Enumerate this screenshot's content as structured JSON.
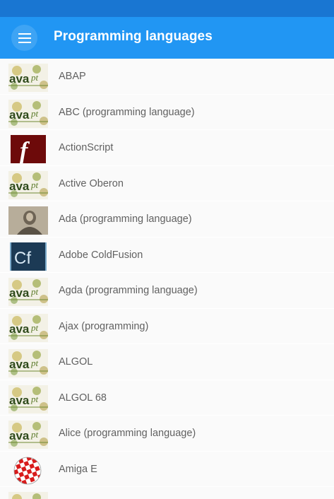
{
  "app_bar": {
    "title": "Programming languages",
    "menu_icon": "hamburger-menu-icon",
    "background": "#2196f3",
    "status_bar_color": "#1976d2"
  },
  "items": [
    {
      "label": "ABAP",
      "icon": "java-logo-icon"
    },
    {
      "label": "ABC (programming language)",
      "icon": "java-logo-icon"
    },
    {
      "label": "ActionScript",
      "icon": "flash-icon"
    },
    {
      "label": "Active Oberon",
      "icon": "java-logo-icon"
    },
    {
      "label": "Ada (programming language)",
      "icon": "ada-portrait-icon"
    },
    {
      "label": "Adobe ColdFusion",
      "icon": "coldfusion-icon"
    },
    {
      "label": "Agda (programming language)",
      "icon": "java-logo-icon"
    },
    {
      "label": "Ajax (programming)",
      "icon": "java-logo-icon"
    },
    {
      "label": "ALGOL",
      "icon": "java-logo-icon"
    },
    {
      "label": "ALGOL 68",
      "icon": "java-logo-icon"
    },
    {
      "label": "Alice (programming language)",
      "icon": "java-logo-icon"
    },
    {
      "label": "Amiga E",
      "icon": "amiga-ball-icon"
    },
    {
      "label": "",
      "icon": "java-logo-icon"
    }
  ]
}
